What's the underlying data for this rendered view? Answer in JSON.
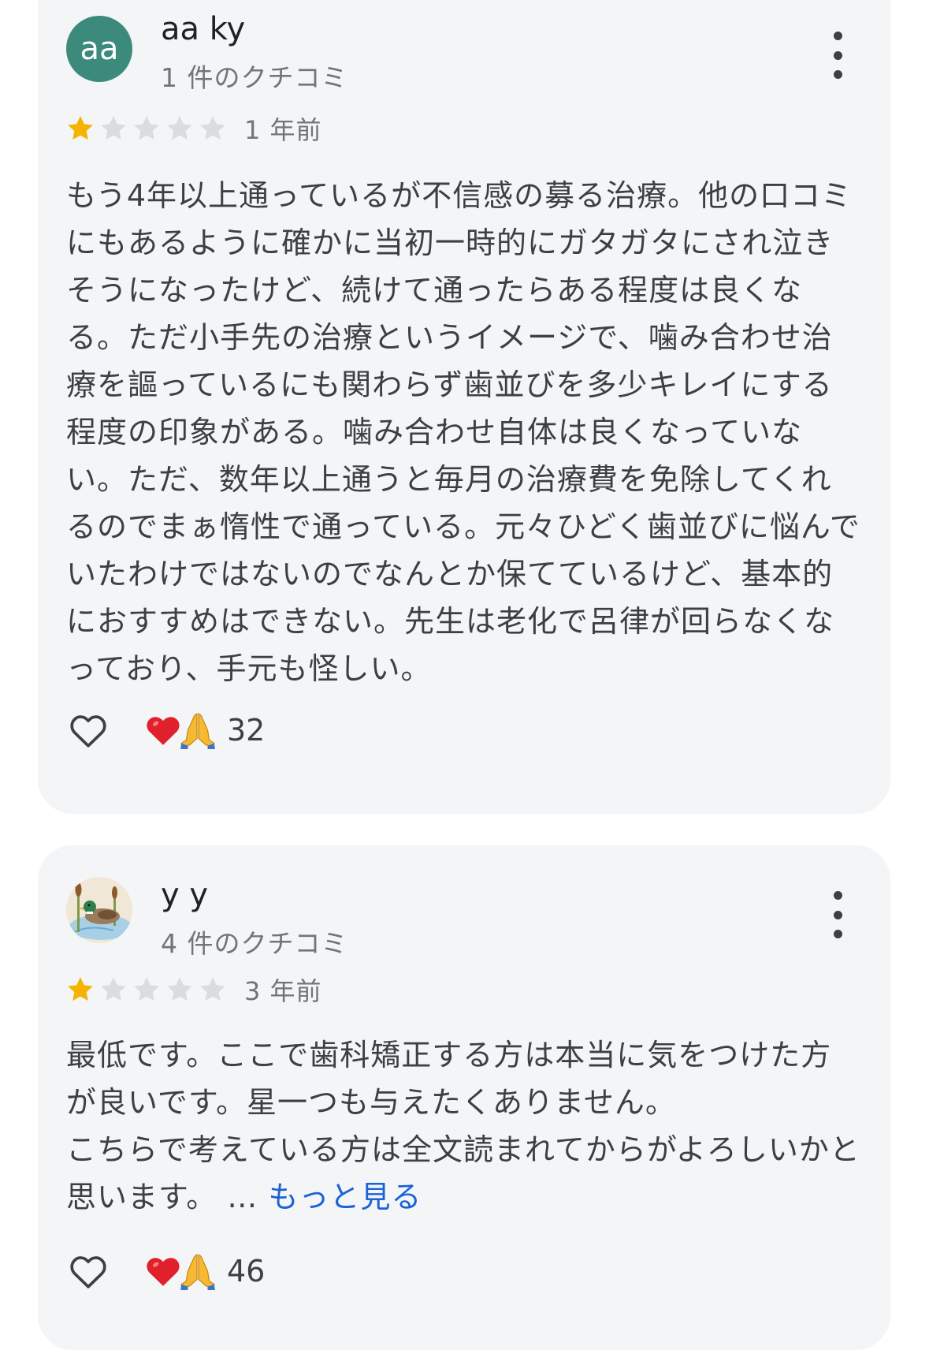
{
  "reviews": [
    {
      "avatar_text": "aa",
      "avatar_color": "#3c8a7c",
      "name": "aa ky",
      "review_count": "1 件のクチコミ",
      "rating": 1,
      "max_rating": 5,
      "time_ago": "1 年前",
      "text": "もう4年以上通っているが不信感の募る治療。他の口コミにもあるように確かに当初一時的にガタガタにされ泣きそうになったけど、続けて通ったらある程度は良くなる。ただ小手先の治療というイメージで、噛み合わせ治療を謳っているにも関わらず歯並びを多少キレイにする程度の印象がある。噛み合わせ自体は良くなっていない。ただ、数年以上通うと毎月の治療費を免除してくれるのでまぁ惰性で通っている。元々ひどく歯並びに悩んでいたわけではないのでなんとか保てているけど、基本的におすすめはできない。先生は老化で呂律が回らなくなっており、手元も怪しい。",
      "more_label": "",
      "reaction_icons": [
        "heart-emoji",
        "folded-hands-emoji"
      ],
      "reaction_count": "32"
    },
    {
      "avatar_text": "",
      "avatar_image": "duck-illustration",
      "name": "y y",
      "review_count": "4 件のクチコミ",
      "rating": 1,
      "max_rating": 5,
      "time_ago": "3 年前",
      "text": "最低です。ここで歯科矯正する方は本当に気をつけた方が良いです。星一つも与えたくありません。\nこちらで考えている方は全文読まれてからがよろしいかと思います。 … ",
      "more_label": "もっと見る",
      "reaction_icons": [
        "heart-emoji",
        "folded-hands-emoji"
      ],
      "reaction_count": "46"
    }
  ],
  "colors": {
    "card_bg": "#f4f5f6",
    "star_filled": "#f4b400",
    "star_empty": "#dadce0",
    "link": "#1a62d6"
  }
}
